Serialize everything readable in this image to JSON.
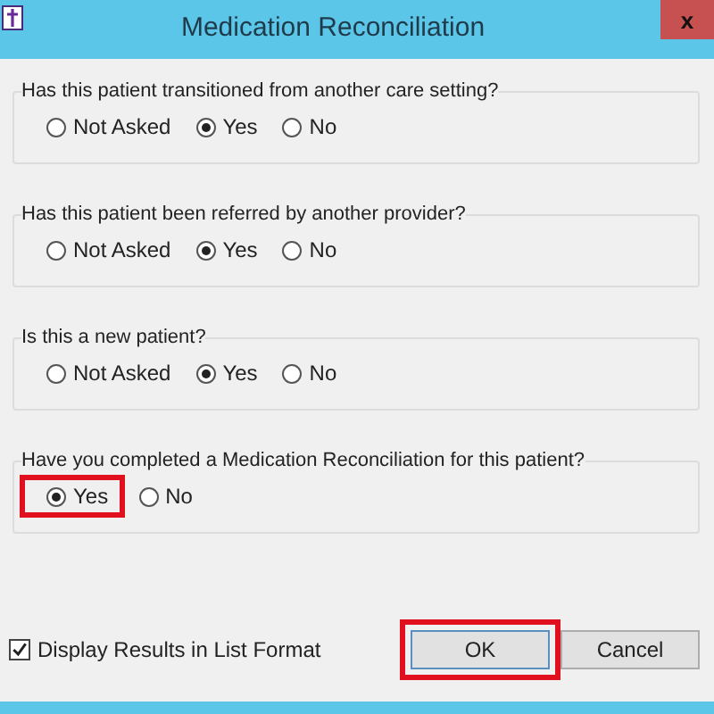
{
  "window": {
    "title": "Medication Reconciliation",
    "close_glyph": "x"
  },
  "questions": [
    {
      "text": "Has this patient transitioned from another care setting?",
      "options": [
        {
          "label": "Not Asked",
          "selected": false,
          "highlighted": false
        },
        {
          "label": "Yes",
          "selected": true,
          "highlighted": false
        },
        {
          "label": "No",
          "selected": false,
          "highlighted": false
        }
      ]
    },
    {
      "text": "Has this patient been referred by another provider?",
      "options": [
        {
          "label": "Not Asked",
          "selected": false,
          "highlighted": false
        },
        {
          "label": "Yes",
          "selected": true,
          "highlighted": false
        },
        {
          "label": "No",
          "selected": false,
          "highlighted": false
        }
      ]
    },
    {
      "text": "Is this a new patient?",
      "options": [
        {
          "label": "Not Asked",
          "selected": false,
          "highlighted": false
        },
        {
          "label": "Yes",
          "selected": true,
          "highlighted": false
        },
        {
          "label": "No",
          "selected": false,
          "highlighted": false
        }
      ]
    },
    {
      "text": "Have you completed a Medication Reconciliation for this patient?",
      "options": [
        {
          "label": "Yes",
          "selected": true,
          "highlighted": true
        },
        {
          "label": "No",
          "selected": false,
          "highlighted": false
        }
      ]
    }
  ],
  "list_format": {
    "label": "Display Results in List Format",
    "checked": true
  },
  "buttons": [
    {
      "label": "OK",
      "default": true,
      "highlighted": true
    },
    {
      "label": "Cancel",
      "default": false,
      "highlighted": false
    }
  ]
}
